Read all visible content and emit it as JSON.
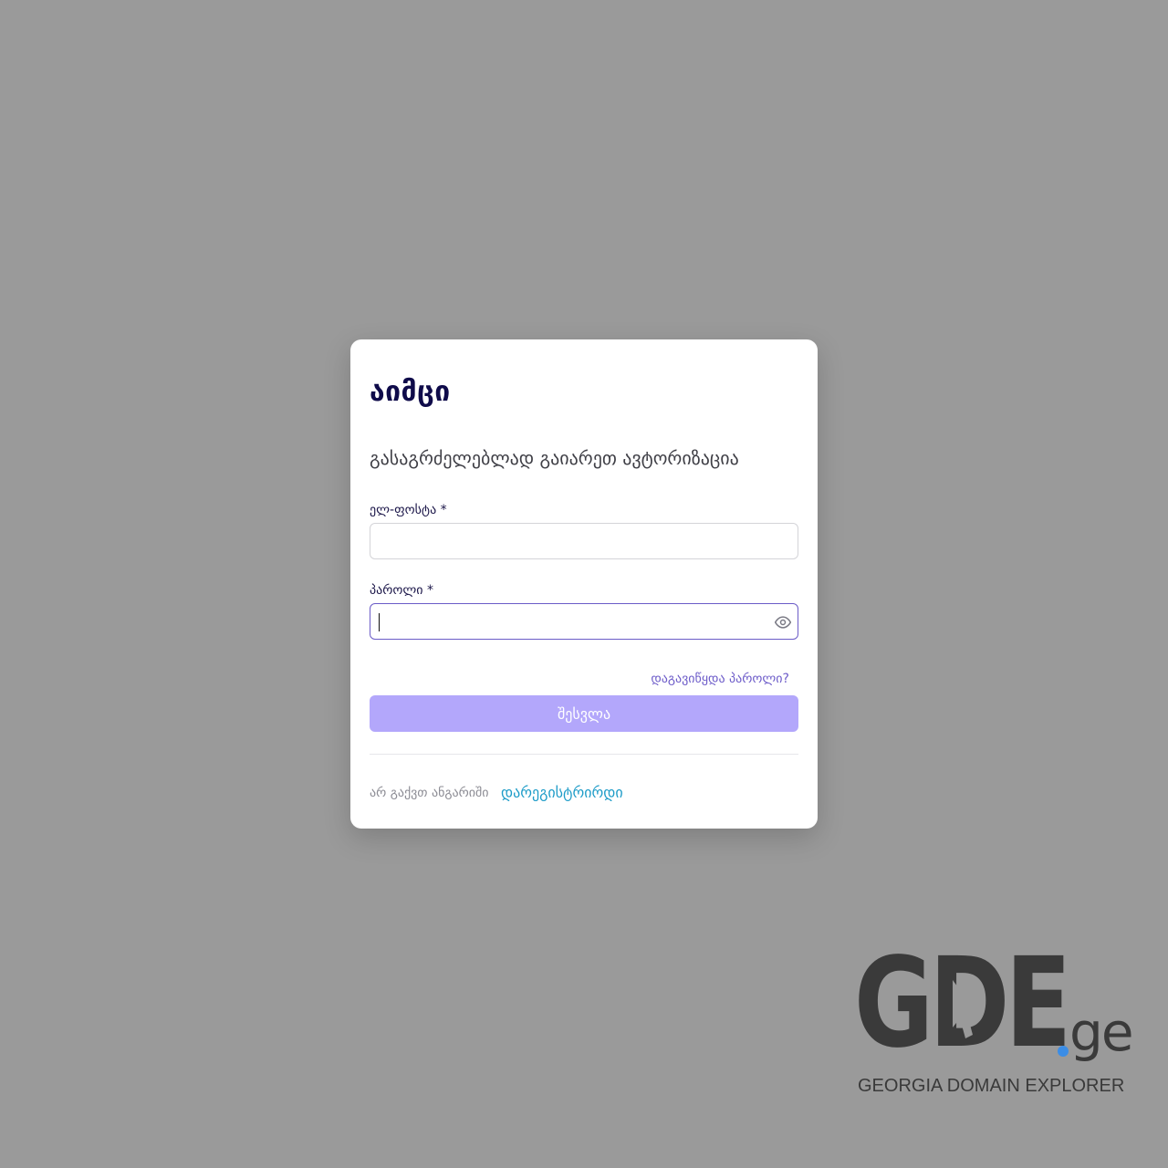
{
  "app": {
    "brand": "აიმცი",
    "subtitle": "გასაგრძელებლად გაიარეთ ავტორიზაცია"
  },
  "form": {
    "email": {
      "label": "ელ-ფოსტა",
      "required_mark": "*",
      "value": "",
      "placeholder": ""
    },
    "password": {
      "label": "პაროლი",
      "required_mark": "*",
      "value": "",
      "placeholder": "",
      "toggle_icon": "eye-icon"
    },
    "forgot_password": "დაგავიწყდა პაროლი?",
    "submit_label": "შესვლა",
    "no_account": "არ გაქვთ ანგარიში",
    "register_link": "დარეგისტრირდი"
  },
  "watermark": {
    "logo_letters": "GDE",
    "tld": "ge",
    "tagline": "GEORGIA DOMAIN EXPLORER"
  },
  "colors": {
    "background": "#9a9a9a",
    "card": "#ffffff",
    "brand_text": "#0f0b4a",
    "accent": "#6d5cc9",
    "button": "#b3a7fb",
    "register_link": "#1e9cc8",
    "watermark_dot": "#3b8de6"
  }
}
